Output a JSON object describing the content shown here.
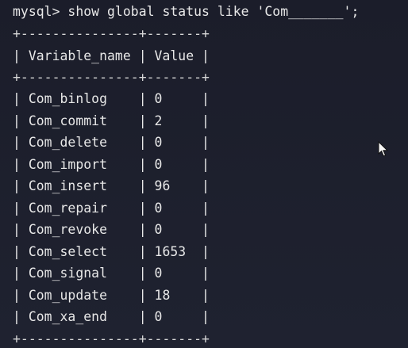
{
  "terminal": {
    "prompt": "mysql> show global status like 'Com_______';",
    "border": "+---------------+-------+",
    "header": "| Variable_name | Value |",
    "rows": [
      "| Com_binlog    | 0     |",
      "| Com_commit    | 2     |",
      "| Com_delete    | 0     |",
      "| Com_import    | 0     |",
      "| Com_insert    | 96    |",
      "| Com_repair    | 0     |",
      "| Com_revoke    | 0     |",
      "| Com_select    | 1653  |",
      "| Com_signal    | 0     |",
      "| Com_update    | 18    |",
      "| Com_xa_end    | 0     |"
    ],
    "colors": {
      "background": "#1d1f2c",
      "text": "#e8e8e8"
    }
  }
}
